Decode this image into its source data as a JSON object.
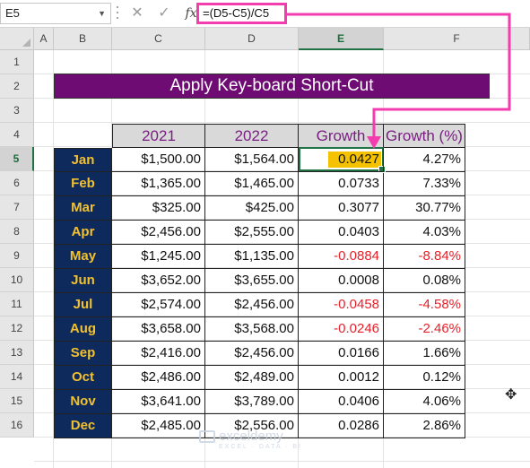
{
  "formula_bar": {
    "name_box": "E5",
    "cancel_icon": "✕",
    "enter_icon": "✓",
    "fx_label": "fx",
    "formula": "=(D5-C5)/C5"
  },
  "column_headers": [
    "A",
    "B",
    "C",
    "D",
    "E",
    "F"
  ],
  "selected_column": "E",
  "row_headers": [
    "1",
    "2",
    "3",
    "4",
    "5",
    "6",
    "7",
    "8",
    "9",
    "10",
    "11",
    "12",
    "13",
    "14",
    "15",
    "16"
  ],
  "selected_row": "5",
  "sheet": {
    "title": "Apply Key-board Short-Cut",
    "table_headers": [
      "",
      "2021",
      "2022",
      "Growth",
      "Growth (%)"
    ],
    "rows": [
      {
        "month": "Jan",
        "y2021": "$1,500.00",
        "y2022": "$1,564.00",
        "growth": "0.0427",
        "growth_pct": "4.27%",
        "negative": false
      },
      {
        "month": "Feb",
        "y2021": "$1,365.00",
        "y2022": "$1,465.00",
        "growth": "0.0733",
        "growth_pct": "7.33%",
        "negative": false
      },
      {
        "month": "Mar",
        "y2021": "$325.00",
        "y2022": "$425.00",
        "growth": "0.3077",
        "growth_pct": "30.77%",
        "negative": false
      },
      {
        "month": "Apr",
        "y2021": "$2,456.00",
        "y2022": "$2,555.00",
        "growth": "0.0403",
        "growth_pct": "4.03%",
        "negative": false
      },
      {
        "month": "May",
        "y2021": "$1,245.00",
        "y2022": "$1,135.00",
        "growth": "-0.0884",
        "growth_pct": "-8.84%",
        "negative": true
      },
      {
        "month": "Jun",
        "y2021": "$3,652.00",
        "y2022": "$3,655.00",
        "growth": "0.0008",
        "growth_pct": "0.08%",
        "negative": false
      },
      {
        "month": "Jul",
        "y2021": "$2,574.00",
        "y2022": "$2,456.00",
        "growth": "-0.0458",
        "growth_pct": "-4.58%",
        "negative": true
      },
      {
        "month": "Aug",
        "y2021": "$3,658.00",
        "y2022": "$3,568.00",
        "growth": "-0.0246",
        "growth_pct": "-2.46%",
        "negative": true
      },
      {
        "month": "Sep",
        "y2021": "$2,416.00",
        "y2022": "$2,456.00",
        "growth": "0.0166",
        "growth_pct": "1.66%",
        "negative": false
      },
      {
        "month": "Oct",
        "y2021": "$2,486.00",
        "y2022": "$2,489.00",
        "growth": "0.0012",
        "growth_pct": "0.12%",
        "negative": false
      },
      {
        "month": "Nov",
        "y2021": "$3,641.00",
        "y2022": "$3,789.00",
        "growth": "0.0406",
        "growth_pct": "4.06%",
        "negative": false
      },
      {
        "month": "Dec",
        "y2021": "$2,485.00",
        "y2022": "$2,556.00",
        "growth": "0.0286",
        "growth_pct": "2.86%",
        "negative": false
      }
    ]
  },
  "watermark": {
    "name": "exceldemy",
    "tagline": "EXCEL · DATA · BI"
  },
  "colors": {
    "accent_pink": "#f33cae",
    "title_bg": "#6e0c73",
    "month_bg": "#0e2a5c",
    "month_text": "#f2c12e",
    "negative": "#e8202a",
    "highlight": "#f5c200",
    "selection": "#217346"
  }
}
